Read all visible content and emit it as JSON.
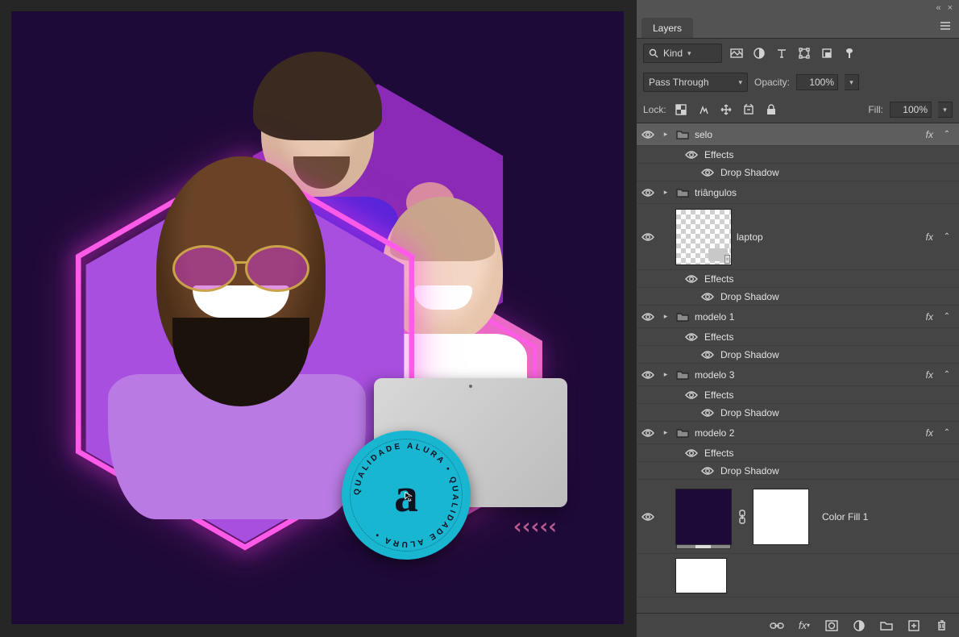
{
  "panel": {
    "tab": "Layers",
    "filter_label": "Kind",
    "blend_mode": "Pass Through",
    "opacity_label": "Opacity:",
    "opacity_value": "100%",
    "lock_label": "Lock:",
    "fill_label": "Fill:",
    "fill_value": "100%"
  },
  "layers": [
    {
      "name": "selo",
      "folder": true,
      "fx": true,
      "selected": true,
      "effects": [
        "Drop Shadow"
      ]
    },
    {
      "name": "triângulos",
      "folder": true
    },
    {
      "name": "laptop",
      "thumb": "laptop",
      "fx": true,
      "effects": [
        "Drop Shadow"
      ]
    },
    {
      "name": "modelo 1",
      "folder": true,
      "fx": true,
      "effects": [
        "Drop Shadow"
      ]
    },
    {
      "name": "modelo 3",
      "folder": true,
      "fx": true,
      "effects": [
        "Drop Shadow"
      ]
    },
    {
      "name": "modelo 2",
      "folder": true,
      "fx": true,
      "effects": [
        "Drop Shadow"
      ]
    },
    {
      "name": "Color Fill 1",
      "thumb": "colorfill",
      "linked": true
    }
  ],
  "effects_label": "Effects",
  "badge": {
    "letter": "a",
    "ring_text": "QUALIDADE ALURA • QUALIDADE ALURA •"
  },
  "chevrons": "‹‹‹‹‹"
}
